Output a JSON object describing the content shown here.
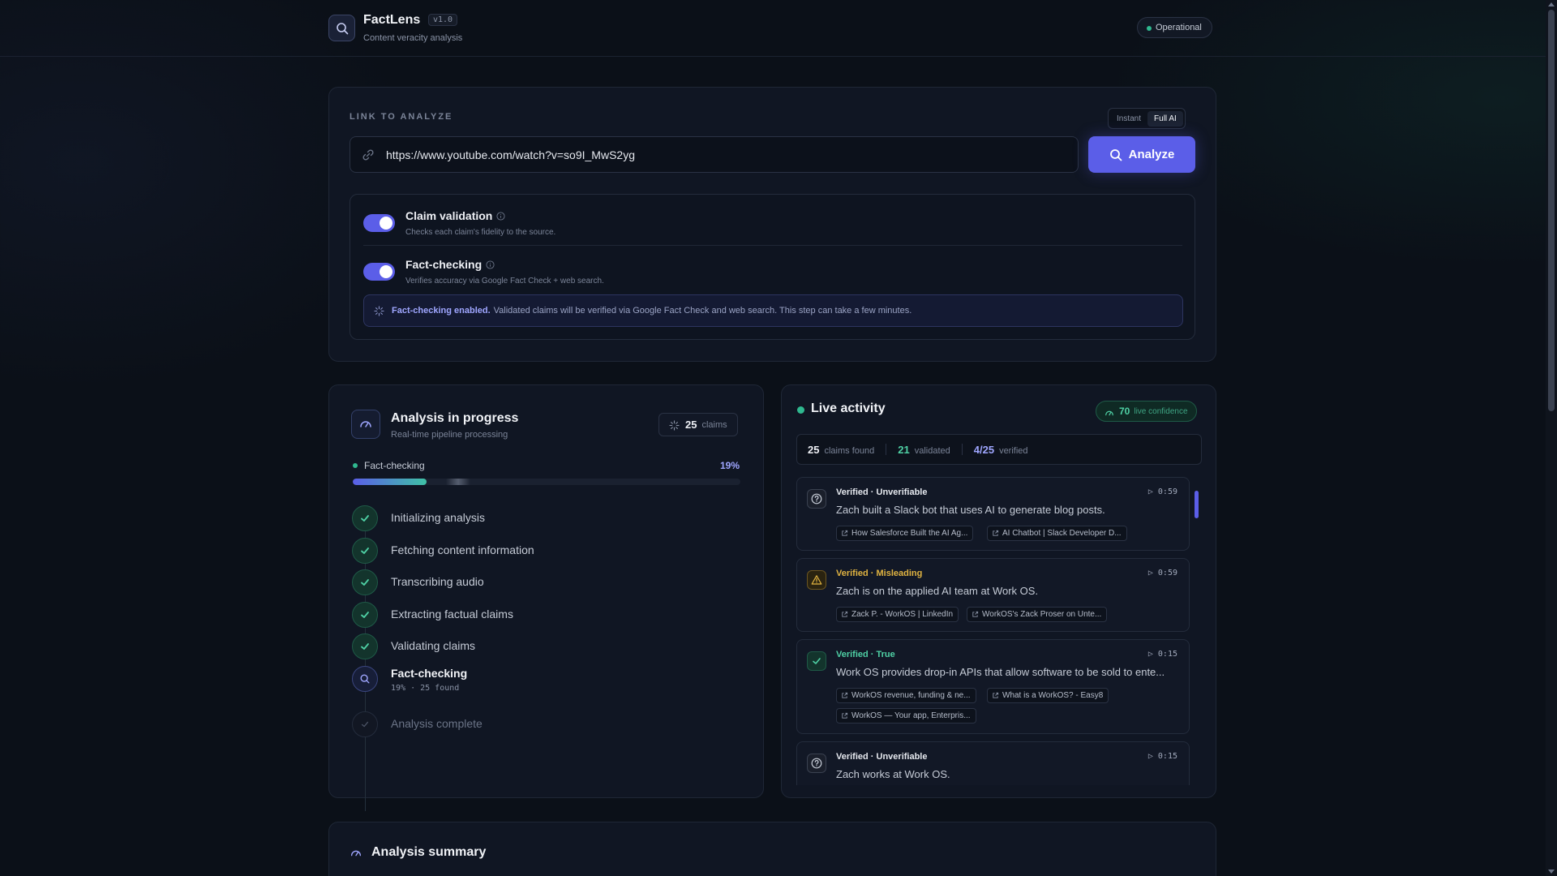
{
  "header": {
    "app_title": "FactLens",
    "version": "v1.0",
    "subtitle": "Content veracity analysis",
    "status": "Operational"
  },
  "input": {
    "label": "LINK TO ANALYZE",
    "modes": [
      "Instant",
      "Full AI"
    ],
    "active_mode": "Full AI",
    "url": "https://www.youtube.com/watch?v=so9I_MwS2yg",
    "analyze_label": "Analyze",
    "options": [
      {
        "title": "Claim validation",
        "desc": "Checks each claim's fidelity to the source.",
        "enabled": true
      },
      {
        "title": "Fact-checking",
        "desc": "Verifies accuracy via Google Fact Check + web search.",
        "enabled": true
      }
    ],
    "notice_bold": "Fact-checking enabled.",
    "notice_text": "Validated claims will be verified via Google Fact Check and web search. This step can take a few minutes."
  },
  "progress": {
    "title": "Analysis in progress",
    "subtitle": "Real-time pipeline processing",
    "claims_count": "25",
    "claims_label": "claims",
    "phase": "Fact-checking",
    "percent_label": "19%",
    "percent_value": 0.19,
    "steps": [
      {
        "label": "Initializing analysis",
        "state": "done"
      },
      {
        "label": "Fetching content information",
        "state": "done"
      },
      {
        "label": "Transcribing audio",
        "state": "done"
      },
      {
        "label": "Extracting factual claims",
        "state": "done"
      },
      {
        "label": "Validating claims",
        "state": "done"
      },
      {
        "label": "Fact-checking",
        "state": "active",
        "meta": "19% · 25 found"
      },
      {
        "label": "Analysis complete",
        "state": "pending"
      }
    ]
  },
  "live": {
    "title": "Live activity",
    "confidence": "70",
    "confidence_label": "live confidence",
    "stats": {
      "claims_found": "25",
      "claims_found_label": "claims found",
      "validated": "21",
      "validated_label": "validated",
      "verified": "4/25",
      "verified_label": "verified"
    },
    "items": [
      {
        "status": "Verified · Unverifiable",
        "kind": "unverifiable",
        "time": "▷ 0:59",
        "text": "Zach built a Slack bot that uses AI to generate blog posts.",
        "sources": [
          "How Salesforce Built the AI Ag...",
          "AI Chatbot | Slack Developer D..."
        ]
      },
      {
        "status": "Verified · Misleading",
        "kind": "misleading",
        "time": "▷ 0:59",
        "text": "Zach is on the applied AI team at Work OS.",
        "sources": [
          "Zack P. - WorkOS | LinkedIn",
          "WorkOS's Zack Proser on Unte..."
        ]
      },
      {
        "status": "Verified · True",
        "kind": "true",
        "time": "▷ 0:15",
        "text": "Work OS provides drop-in APIs that allow software to be sold to ente...",
        "sources": [
          "WorkOS revenue, funding & ne...",
          "What is a WorkOS? - Easy8",
          "WorkOS — Your app, Enterpris..."
        ]
      },
      {
        "status": "Verified · Unverifiable",
        "kind": "unverifiable",
        "time": "▷ 0:15",
        "text": "Zach works at Work OS.",
        "sources": []
      }
    ]
  },
  "summary": {
    "title": "Analysis summary"
  },
  "colors": {
    "accent": "#5b5ee8",
    "success": "#2fb88f",
    "warning": "#e0b341",
    "background": "#0b1018"
  }
}
